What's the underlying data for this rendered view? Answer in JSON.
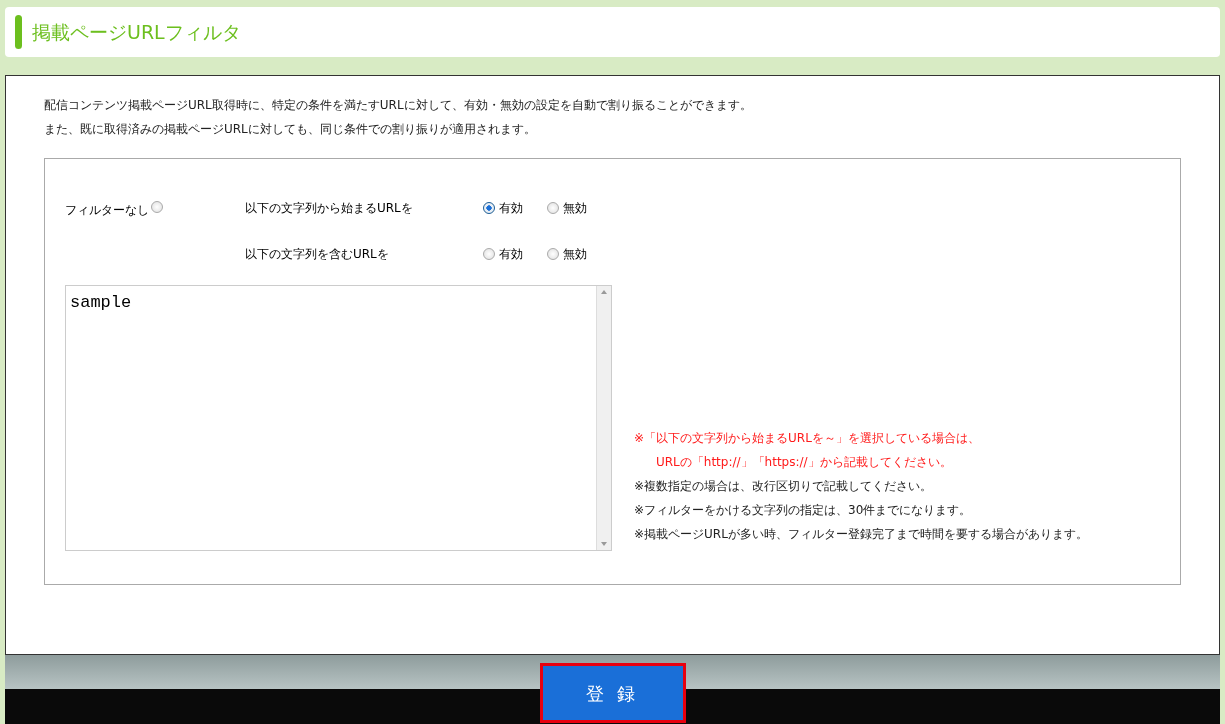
{
  "title": "掲載ページURLフィルタ",
  "description": [
    "配信コンテンツ掲載ページURL取得時に、特定の条件を満たすURLに対して、有効・無効の設定を自動で割り振ることができます。",
    "また、既に取得済みの掲載ページURLに対しても、同じ条件での割り振りが適用されます。"
  ],
  "filter_none": {
    "label": "フィルターなし",
    "selected": false
  },
  "rules": [
    {
      "label": "以下の文字列から始まるURLを",
      "options": [
        {
          "label": "有効",
          "selected": true
        },
        {
          "label": "無効",
          "selected": false
        }
      ]
    },
    {
      "label": "以下の文字列を含むURLを",
      "options": [
        {
          "label": "有効",
          "selected": false
        },
        {
          "label": "無効",
          "selected": false
        }
      ]
    }
  ],
  "textarea": {
    "value": "sample"
  },
  "notes": [
    {
      "kind": "warning",
      "text": "※「以下の文字列から始まるURLを～」を選択している場合は、"
    },
    {
      "kind": "warning-indent",
      "text": "URLの「http://」「https://」から記載してください。"
    },
    {
      "kind": "normal",
      "text": "※複数指定の場合は、改行区切りで記載してください。"
    },
    {
      "kind": "normal",
      "text": "※フィルターをかける文字列の指定は、30件までになります。"
    },
    {
      "kind": "normal",
      "text": "※掲載ページURLが多い時、フィルター登録完了まで時間を要する場合があります。"
    }
  ],
  "submit_button": "登 録"
}
